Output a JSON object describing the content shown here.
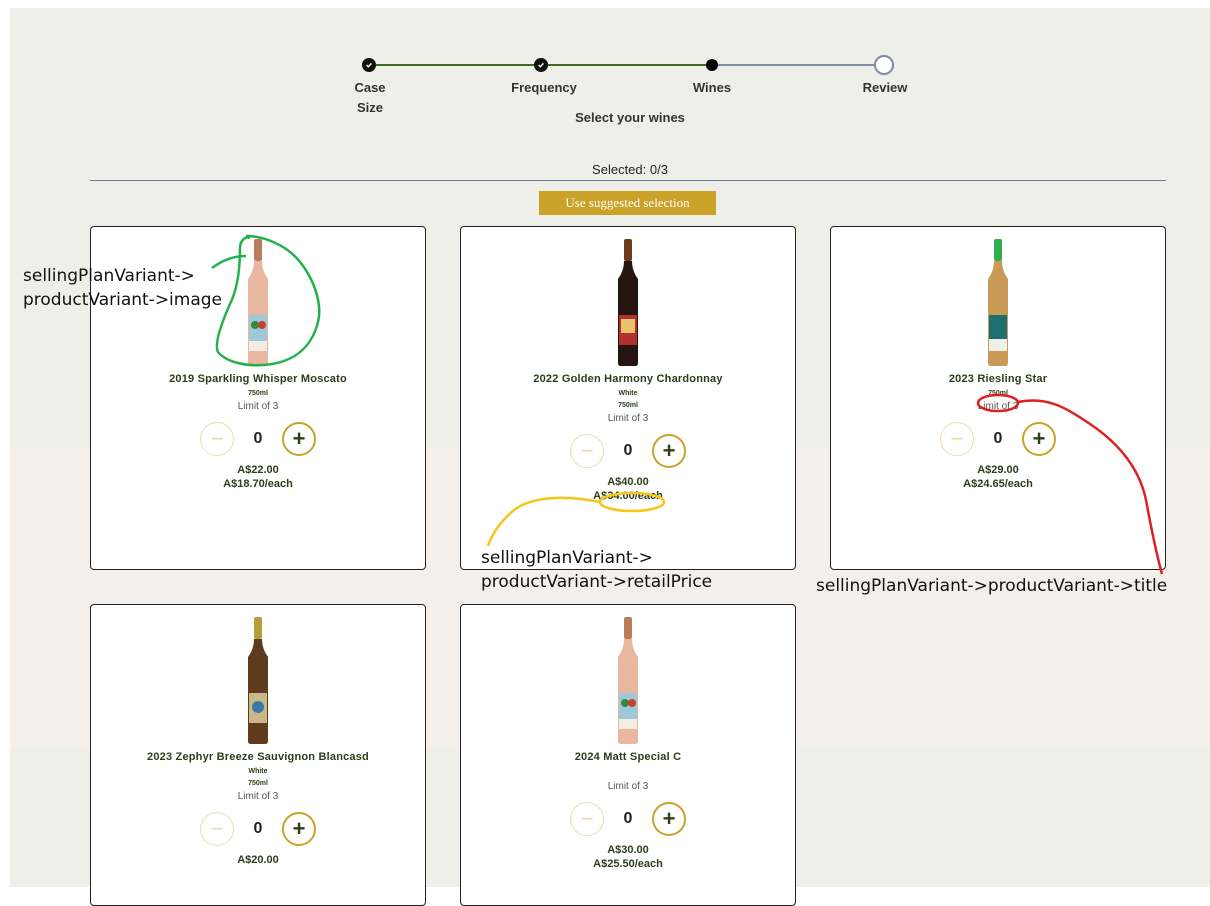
{
  "stepper": {
    "steps": [
      {
        "label_line1": "Case",
        "label_line2": "Size",
        "state": "complete"
      },
      {
        "label_line1": "Frequency",
        "label_line2": "",
        "state": "complete"
      },
      {
        "label_line1": "Wines",
        "label_line2": "",
        "state": "current"
      },
      {
        "label_line1": "Review",
        "label_line2": "",
        "state": "upcoming"
      }
    ],
    "subtitle": "Select your wines"
  },
  "selection": {
    "count_text": "Selected: 0/3",
    "suggest_button": "Use suggested selection"
  },
  "products": [
    {
      "name": "2019 Sparkling Whisper Moscato",
      "type": "",
      "size": "750ml",
      "limit": "Limit of 3",
      "qty": "0",
      "retail": "A$22.00",
      "each": "A$18.70/each",
      "bottle": "rose"
    },
    {
      "name": "2022 Golden Harmony Chardonnay",
      "type": "White",
      "size": "750ml",
      "limit": "Limit of 3",
      "qty": "0",
      "retail": "A$40.00",
      "each": "A$34.00/each",
      "bottle": "dark"
    },
    {
      "name": "2023 Riesling Star",
      "type": "",
      "size": "750ml",
      "limit": "Limit of 3",
      "qty": "0",
      "retail": "A$29.00",
      "each": "A$24.65/each",
      "bottle": "green-cap"
    },
    {
      "name": "2023 Zephyr Breeze Sauvignon Blancasd",
      "type": "White",
      "size": "750ml",
      "limit": "Limit of 3",
      "qty": "0",
      "retail": "A$20.00",
      "each": "",
      "bottle": "gold-cap"
    },
    {
      "name": "2024 Matt Special C",
      "type": "",
      "size": "",
      "limit": "Limit of 3",
      "qty": "0",
      "retail": "A$30.00",
      "each": "A$25.50/each",
      "bottle": "rose"
    }
  ],
  "annotations": {
    "image_line1": "sellingPlanVariant->",
    "image_line2": "productVariant->image",
    "price_line1": "sellingPlanVariant->",
    "price_line2": "productVariant->retailPrice",
    "title_line": "sellingPlanVariant->productVariant->title"
  },
  "icons": {
    "minus": "minus-icon",
    "plus": "plus-icon",
    "check": "check-icon"
  },
  "colors": {
    "accent_gold": "#c9a227",
    "text_green": "#2c3e1a",
    "progress_complete": "#3d6b1f",
    "progress_pending": "#7f8aa3",
    "annotation_green": "#22b14c",
    "annotation_yellow": "#f5c518",
    "annotation_red": "#e02020"
  }
}
